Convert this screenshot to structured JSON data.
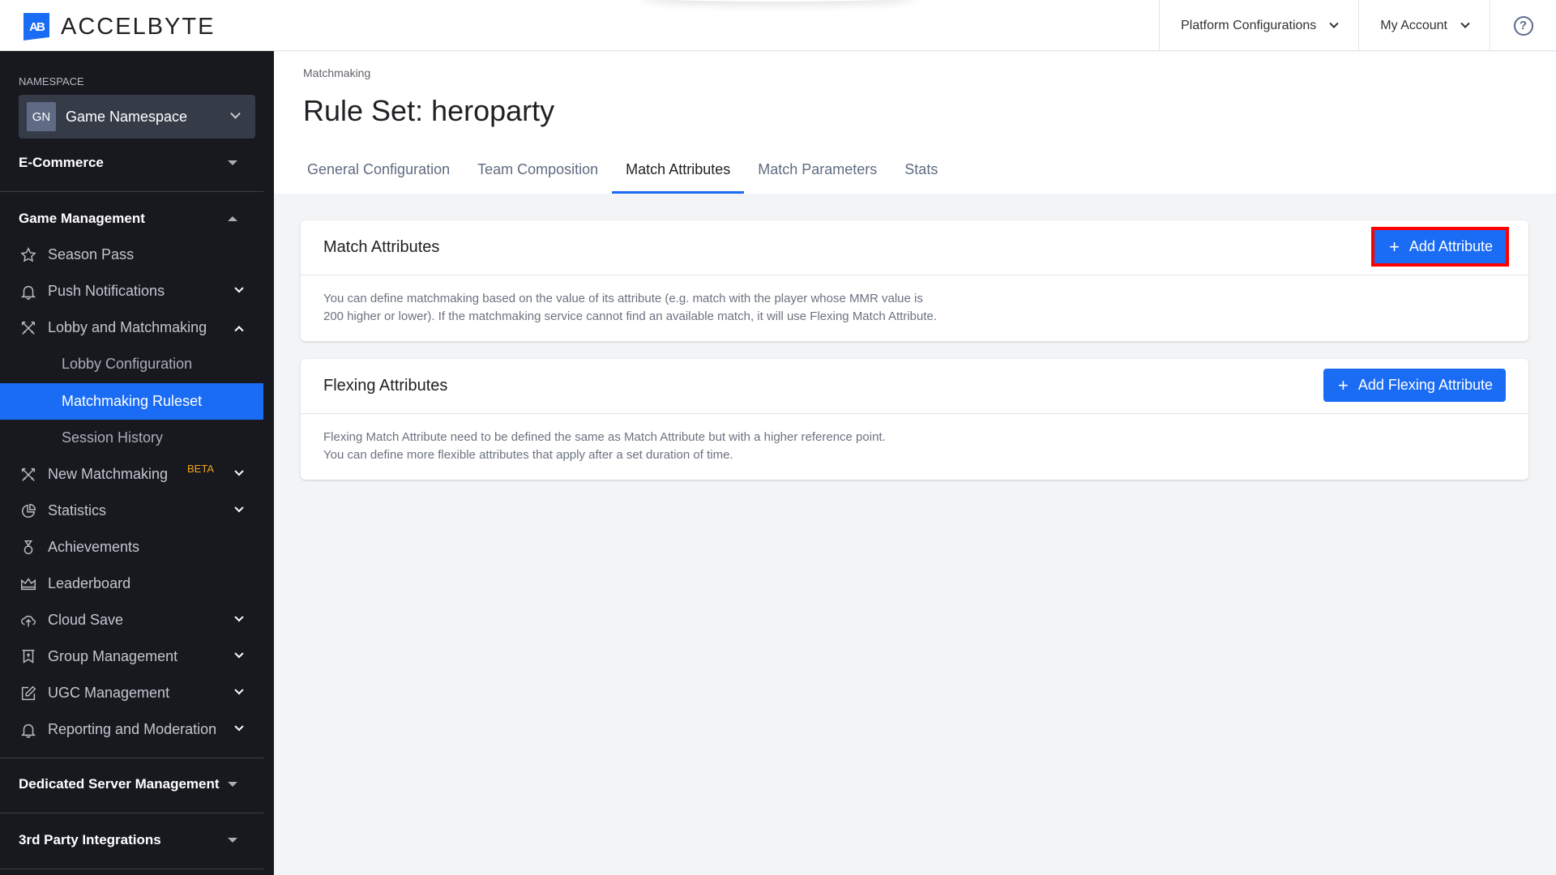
{
  "header": {
    "logo_mark": "AB",
    "logo_text": "ACCELBYTE",
    "platform_configurations": "Platform Configurations",
    "my_account": "My Account",
    "help": "?"
  },
  "sidebar": {
    "namespace_label": "NAMESPACE",
    "namespace_badge": "GN",
    "namespace_name": "Game Namespace",
    "sections": {
      "ecommerce": "E-Commerce",
      "game_management": "Game Management",
      "dedicated_server": "Dedicated Server Management",
      "third_party": "3rd Party Integrations"
    },
    "items": {
      "season_pass": "Season Pass",
      "push_notifications": "Push Notifications",
      "lobby_matchmaking": "Lobby and Matchmaking",
      "lobby_configuration": "Lobby Configuration",
      "matchmaking_ruleset": "Matchmaking Ruleset",
      "session_history": "Session History",
      "new_matchmaking": "New Matchmaking",
      "new_matchmaking_badge": "BETA",
      "statistics": "Statistics",
      "achievements": "Achievements",
      "leaderboard": "Leaderboard",
      "cloud_save": "Cloud Save",
      "group_management": "Group Management",
      "ugc_management": "UGC Management",
      "reporting_moderation": "Reporting and Moderation"
    }
  },
  "main": {
    "breadcrumb": "Matchmaking",
    "title": "Rule Set: heroparty",
    "tabs": [
      {
        "label": "General Configuration",
        "active": false
      },
      {
        "label": "Team Composition",
        "active": false
      },
      {
        "label": "Match Attributes",
        "active": true
      },
      {
        "label": "Match Parameters",
        "active": false
      },
      {
        "label": "Stats",
        "active": false
      }
    ],
    "match_attributes": {
      "title": "Match Attributes",
      "button": "Add Attribute",
      "line1": "You can define matchmaking based on the value of its attribute (e.g. match with the player whose MMR value is",
      "line2": "200 higher or lower). If the matchmaking service cannot find an available match, it will use Flexing Match Attribute."
    },
    "flexing_attributes": {
      "title": "Flexing Attributes",
      "button": "Add Flexing Attribute",
      "line1": "Flexing Match Attribute need to be defined the same as Match Attribute but with a higher reference point.",
      "line2": "You can define more flexible attributes that apply after a set duration of time."
    }
  },
  "colors": {
    "accent": "#1a6cf5",
    "sidebar_bg": "#17191f",
    "highlight_outline": "#ff0000",
    "beta": "#f0a31c"
  }
}
